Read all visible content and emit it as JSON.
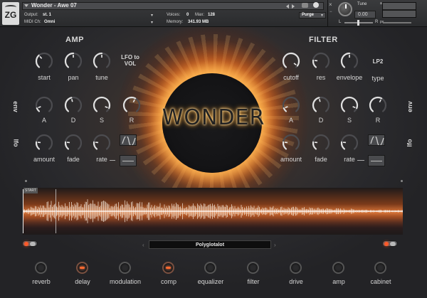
{
  "header": {
    "logo": "ZG",
    "preset_name": "Wonder - Awe 07",
    "output_label": "Output:",
    "output_value": "st. 1",
    "midi_label": "MIDI Ch:",
    "midi_value": "Omni",
    "voices_label": "Voices:",
    "voices_value": "0",
    "max_label": "Max:",
    "max_value": "128",
    "memory_label": "Memory:",
    "memory_value": "341.93 MB",
    "purge_label": "Purge",
    "tune_label": "Tune",
    "tune_value": "0.00",
    "close_label": "×",
    "aux_label": "aux",
    "pv_label": "pv",
    "l_label": "L",
    "r_label": "R"
  },
  "title": "WONDER",
  "amp": {
    "section_title": "AMP",
    "row1": [
      {
        "label": "start",
        "value": 0.35
      },
      {
        "label": "pan",
        "value": 0.5
      },
      {
        "label": "tune",
        "value": 0.5
      }
    ],
    "lfo_target": "LFO to VOL",
    "env_side_label": "env",
    "env": [
      {
        "label": "A",
        "value": 0.1
      },
      {
        "label": "D",
        "value": 0.45
      },
      {
        "label": "S",
        "value": 0.9
      },
      {
        "label": "R",
        "value": 0.6
      }
    ],
    "lfo_side_label": "lfo",
    "lfo": [
      {
        "label": "amount",
        "value": 0.2
      },
      {
        "label": "fade",
        "value": 0.2
      },
      {
        "label": "rate",
        "value": 0.2
      }
    ]
  },
  "filter": {
    "section_title": "FILTER",
    "row1": [
      {
        "label": "cutoff",
        "value": 0.95
      },
      {
        "label": "res",
        "value": 0.2
      },
      {
        "label": "envelope",
        "value": 0.5
      }
    ],
    "type_value": "LP2",
    "type_label": "type",
    "env_side_label": "env",
    "env": [
      {
        "label": "A",
        "value": 0.1
      },
      {
        "label": "D",
        "value": 0.45
      },
      {
        "label": "S",
        "value": 0.9
      },
      {
        "label": "R",
        "value": 0.6
      }
    ],
    "lfo_side_label": "lfo",
    "lfo": [
      {
        "label": "amount",
        "value": 0.2
      },
      {
        "label": "fade",
        "value": 0.2
      },
      {
        "label": "rate",
        "value": 0.2
      }
    ]
  },
  "waveform": {
    "start_label": "START"
  },
  "sample_selector": {
    "value": "Polyglotalot"
  },
  "effects": [
    {
      "label": "reverb",
      "active": false
    },
    {
      "label": "delay",
      "active": true
    },
    {
      "label": "modulation",
      "active": false
    },
    {
      "label": "comp",
      "active": true
    },
    {
      "label": "equalizer",
      "active": false
    },
    {
      "label": "filter",
      "active": false
    },
    {
      "label": "drive",
      "active": false
    },
    {
      "label": "amp",
      "active": false
    },
    {
      "label": "cabinet",
      "active": false
    }
  ],
  "colors": {
    "accent": "#ff5a2a",
    "knob_arc": "#e0e0e0",
    "knob_track": "#4c4c50",
    "panel": "#2a2a2d"
  }
}
